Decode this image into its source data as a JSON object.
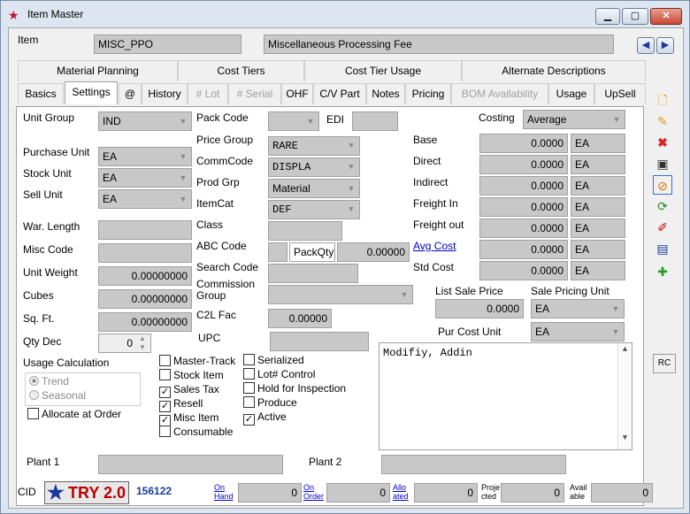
{
  "window": {
    "title": "Item Master"
  },
  "header": {
    "item_label": "Item",
    "item_code": "MISC_PPO",
    "item_desc": "Miscellaneous Processing Fee"
  },
  "tabs_top": [
    "Material Planning",
    "Cost Tiers",
    "Cost Tier Usage",
    "Alternate Descriptions"
  ],
  "tabs": [
    {
      "label": "Basics"
    },
    {
      "label": "Settings"
    },
    {
      "label": "@"
    },
    {
      "label": "History"
    },
    {
      "label": "# Lot"
    },
    {
      "label": "# Serial"
    },
    {
      "label": "OHF"
    },
    {
      "label": "C/V Part"
    },
    {
      "label": "Notes"
    },
    {
      "label": "Pricing"
    },
    {
      "label": "BOM Availability"
    },
    {
      "label": "Usage"
    },
    {
      "label": "UpSell"
    }
  ],
  "left": {
    "unit_group_label": "Unit Group",
    "unit_group": "IND",
    "purchase_unit_label": "Purchase Unit",
    "purchase_unit": "EA",
    "stock_unit_label": "Stock Unit",
    "stock_unit": "EA",
    "sell_unit_label": "Sell Unit",
    "sell_unit": "EA",
    "war_length_label": "War. Length",
    "misc_code_label": "Misc Code",
    "unit_weight_label": "Unit Weight",
    "unit_weight": "0.00000000",
    "cubes_label": "Cubes",
    "cubes": "0.00000000",
    "sqft_label": "Sq. Ft.",
    "sqft": "0.00000000",
    "qty_dec_label": "Qty Dec",
    "qty_dec": "0",
    "usage_calc_label": "Usage Calculation",
    "trend": "Trend",
    "seasonal": "Seasonal",
    "allocate_label": "Allocate at Order"
  },
  "middle": {
    "pack_code_label": "Pack Code",
    "edi_label": "EDI",
    "price_group_label": "Price Group",
    "price_group": "RARE",
    "commcode_label": "CommCode",
    "commcode": "DISPLA",
    "prod_grp_label": "Prod Grp",
    "prod_grp": "Material",
    "itemcat_label": "ItemCat",
    "itemcat": "DEF",
    "class_label": "Class",
    "abc_code_label": "ABC Code",
    "packqty_label": "PackQty",
    "packqty": "0.00000",
    "search_code_label": "Search Code",
    "commission_group_label": "Commission Group",
    "c2l_fac_label": "C2L Fac",
    "c2l_fac": "0.00000",
    "upc_label": "UPC"
  },
  "checkboxes_col1": [
    {
      "label": "Master-Track",
      "checked": false
    },
    {
      "label": "Stock Item",
      "checked": false
    },
    {
      "label": "Sales Tax",
      "checked": true
    },
    {
      "label": "Resell",
      "checked": true
    },
    {
      "label": "Misc Item",
      "checked": true
    },
    {
      "label": "Consumable",
      "checked": false
    }
  ],
  "checkboxes_col2": [
    {
      "label": "Serialized",
      "checked": false
    },
    {
      "label": "Lot# Control",
      "checked": false
    },
    {
      "label": "Hold for Inspection",
      "checked": false
    },
    {
      "label": "Produce",
      "checked": false
    },
    {
      "label": "Active",
      "checked": true
    }
  ],
  "costing": {
    "costing_label": "Costing",
    "costing": "Average",
    "rows": [
      {
        "label": "Base",
        "value": "0.0000",
        "unit": "EA"
      },
      {
        "label": "Direct",
        "value": "0.0000",
        "unit": "EA"
      },
      {
        "label": "Indirect",
        "value": "0.0000",
        "unit": "EA"
      },
      {
        "label": "Freight In",
        "value": "0.0000",
        "unit": "EA"
      },
      {
        "label": "Freight out",
        "value": "0.0000",
        "unit": "EA"
      },
      {
        "label": "Avg Cost",
        "value": "0.0000",
        "unit": "EA"
      },
      {
        "label": "Std Cost",
        "value": "0.0000",
        "unit": "EA"
      }
    ],
    "list_sale_price_label": "List Sale Price",
    "list_sale_price": "0.0000",
    "sale_pricing_unit_label": "Sale Pricing Unit",
    "sale_pricing_unit": "EA",
    "pur_cost_unit_label": "Pur Cost Unit",
    "pur_cost_unit": "EA"
  },
  "notes": {
    "text": "Modifiy, Addin"
  },
  "plants": {
    "plant1_label": "Plant 1",
    "plant2_label": "Plant 2"
  },
  "footer": {
    "cid_label": "CID",
    "logo_text": "TRY 2.0",
    "cid": "156122",
    "on_hand_1": "On",
    "on_hand_2": "Hand",
    "on_hand": "0",
    "on_order_1": "On",
    "on_order_2": "Order",
    "on_order": "0",
    "allocated_1": "Allo",
    "allocated_2": "ated",
    "allocated": "0",
    "projected_1": "Proje",
    "projected_2": "cted",
    "projected": "0",
    "available_1": "Avail",
    "available_2": "able",
    "available": "0"
  },
  "sidebar": {
    "rc_label": "RC"
  }
}
